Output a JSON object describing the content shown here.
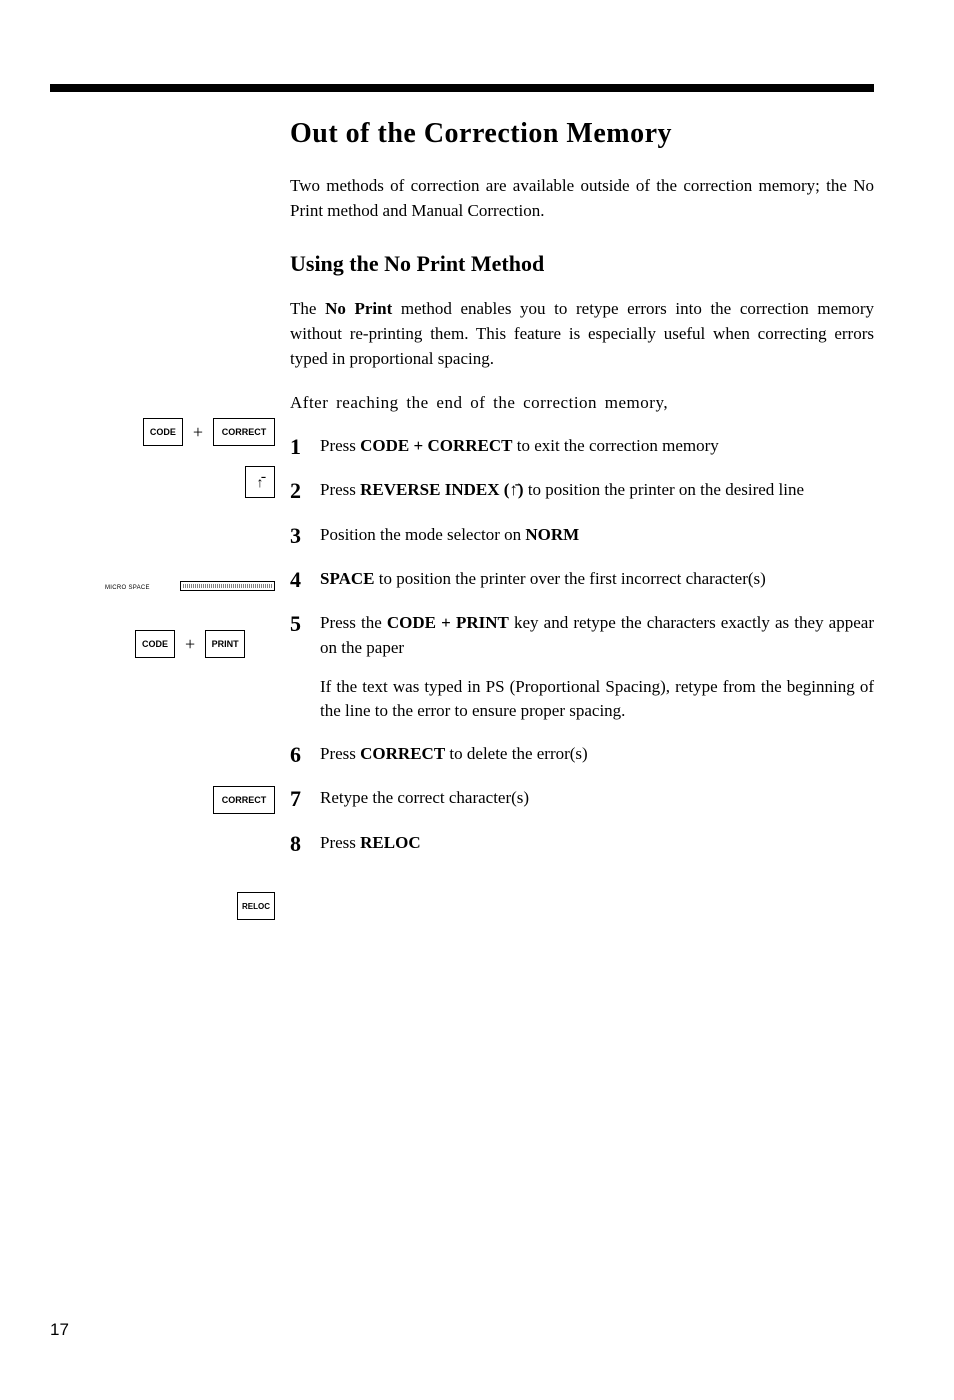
{
  "title": "Out of the Correction Memory",
  "intro": "Two methods of correction are available outside of the correction memory; the No Print method and Manual Correction.",
  "subheading": "Using the No Print Method",
  "body1_a": "The ",
  "body1_b": "No Print",
  "body1_c": " method enables you to retype errors into the correction memory without re-printing them. This feature is espe­cially useful when correcting errors typed in proportional spacing.",
  "lead": "After reaching the end of the correction memory,",
  "steps": {
    "s1": {
      "n": "1",
      "pre": "Press ",
      "key": "CODE + CORRECT",
      "post": " to exit the correction memory"
    },
    "s2": {
      "n": "2",
      "pre": "Press ",
      "key": "REVERSE INDEX (↑̄)",
      "post": " to position the printer on the desired line"
    },
    "s3": {
      "n": "3",
      "pre": "Position the mode selector on ",
      "key": "NORM",
      "post": ""
    },
    "s4": {
      "n": "4",
      "key": "SPACE",
      "post": " to position the printer over the first incorrect character(s)"
    },
    "s5": {
      "n": "5",
      "pre": "Press the ",
      "key": "CODE + PRINT",
      "post": " key and retype the characters exactly as they appear on the paper",
      "note": "If the text was typed in PS (Proportional Spacing), retype from the beginning of the line to the error to ensure proper spacing."
    },
    "s6": {
      "n": "6",
      "pre": "Press ",
      "key": "CORRECT",
      "post": " to delete the error(s)"
    },
    "s7": {
      "n": "7",
      "txt": "Retype the correct character(s)"
    },
    "s8": {
      "n": "8",
      "pre": "Press ",
      "key": "RELOC",
      "post": ""
    }
  },
  "keys": {
    "code": "CODE",
    "correct": "CORRECT",
    "rev": "↑̄",
    "micro": "MICRO SPACE",
    "print": "PRINT",
    "reloc": "RELOC"
  },
  "page_number": "17"
}
